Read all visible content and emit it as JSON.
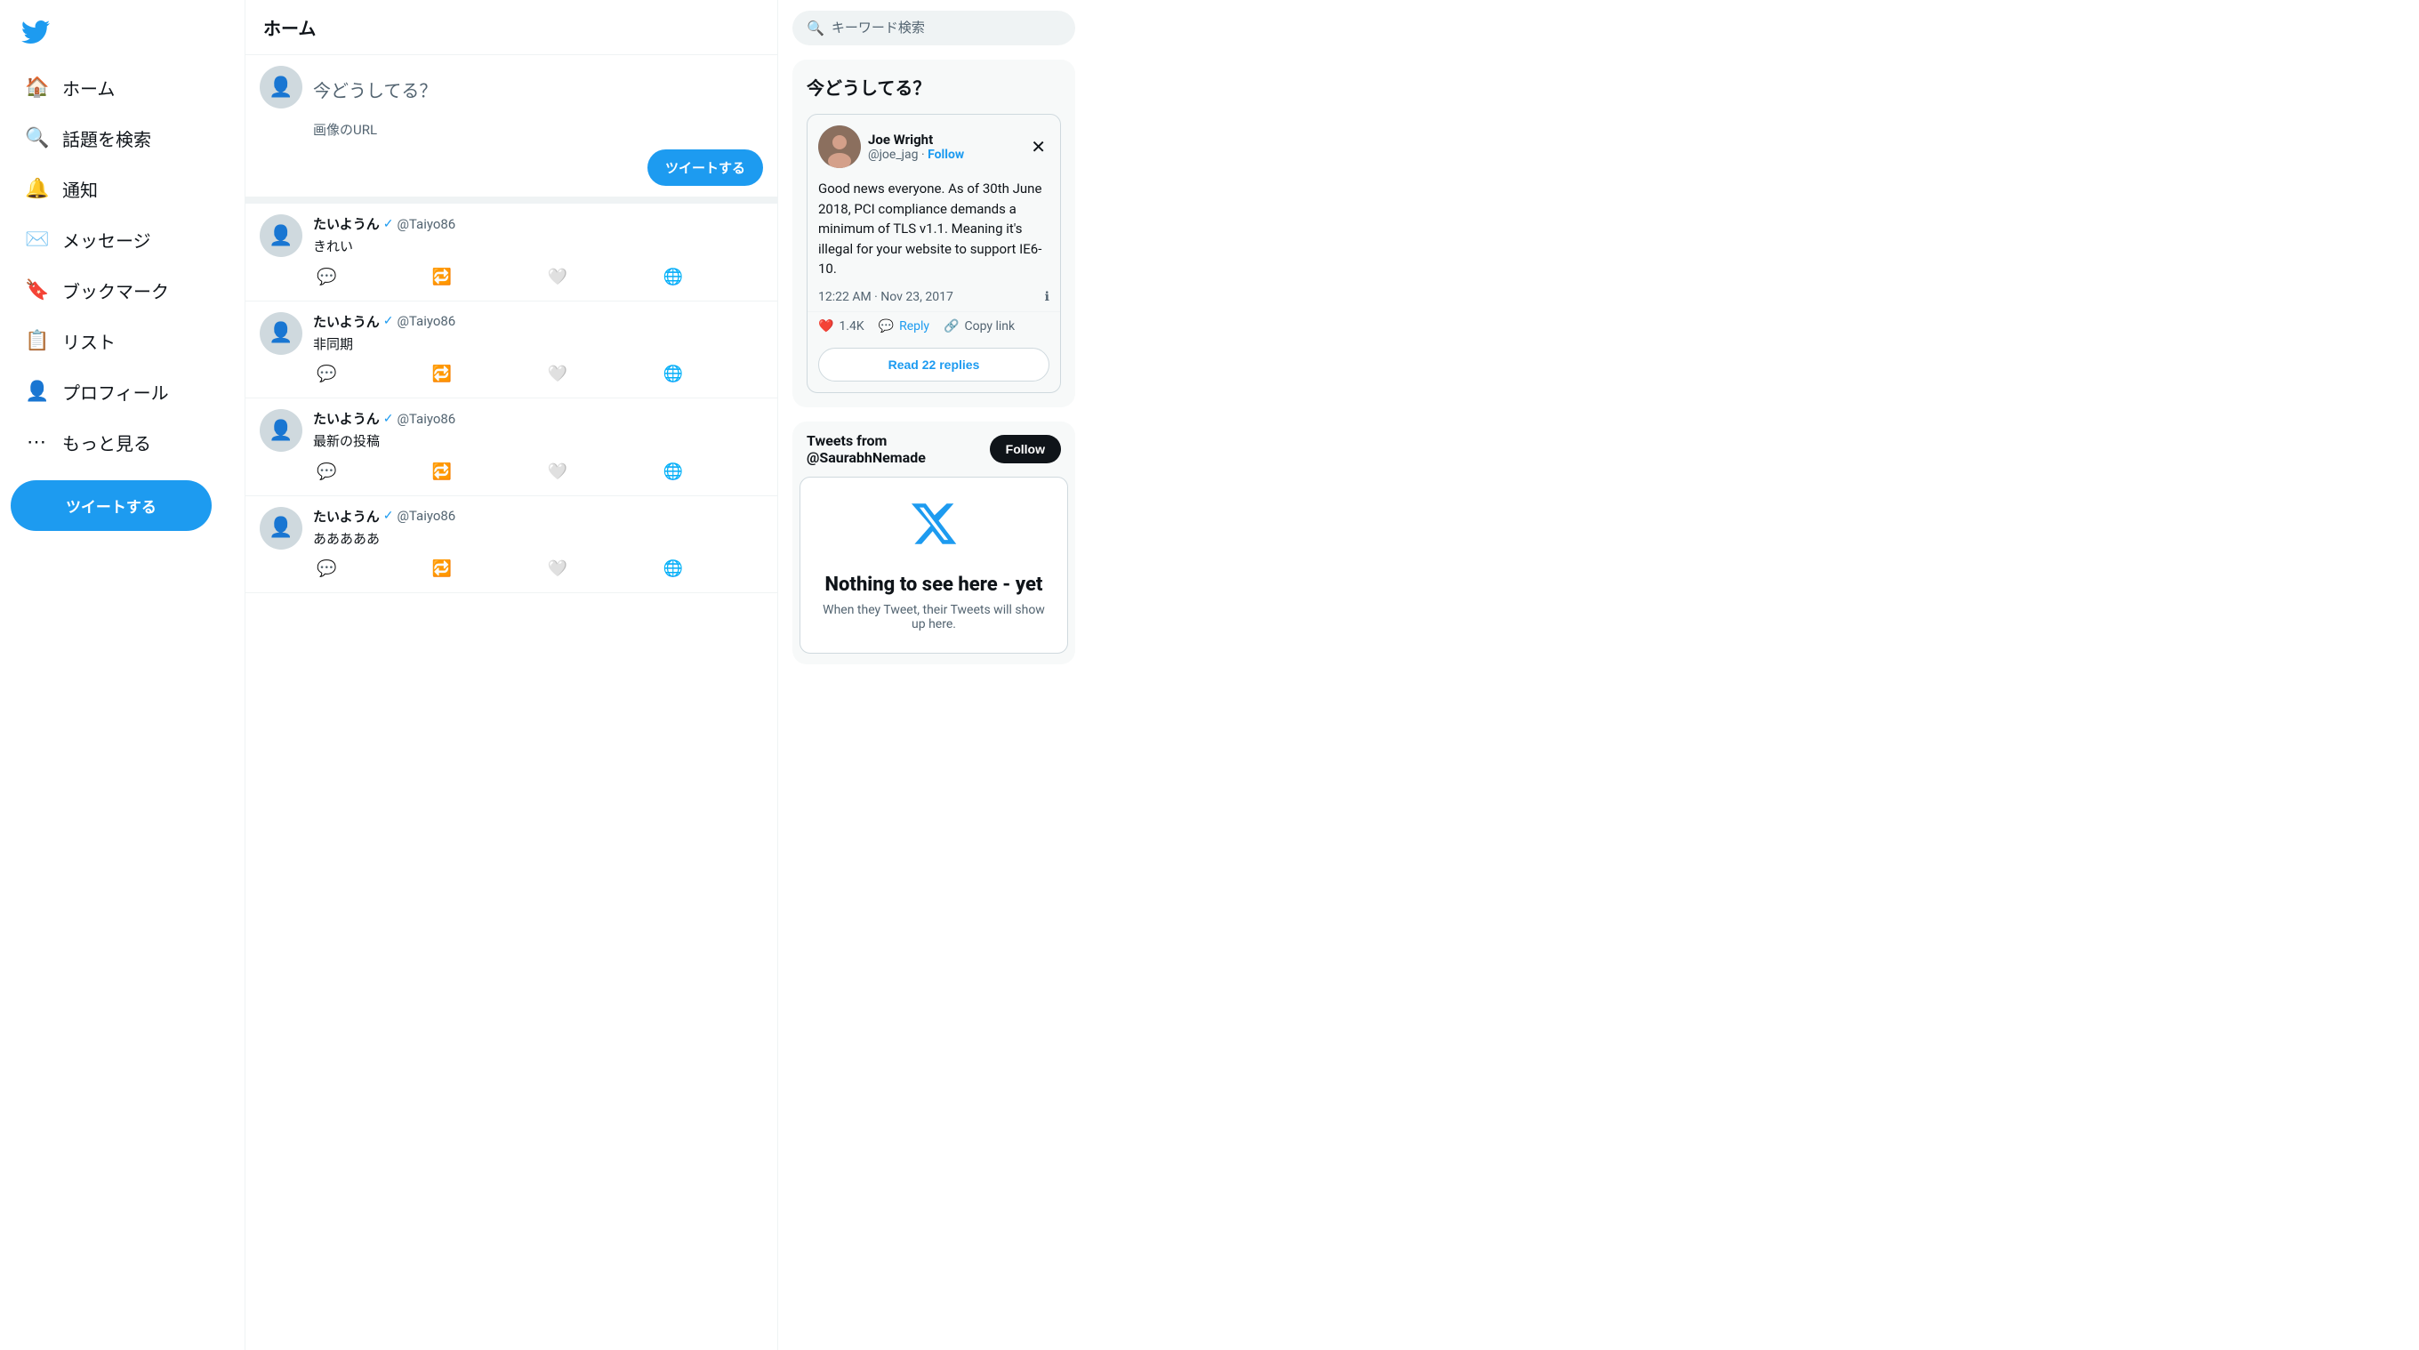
{
  "sidebar": {
    "logo_label": "Twitter",
    "nav_items": [
      {
        "id": "home",
        "label": "ホーム",
        "icon": "🏠"
      },
      {
        "id": "explore",
        "label": "話題を検索",
        "icon": "🔍"
      },
      {
        "id": "notifications",
        "label": "通知",
        "icon": "🔔"
      },
      {
        "id": "messages",
        "label": "メッセージ",
        "icon": "✉️"
      },
      {
        "id": "bookmarks",
        "label": "ブックマーク",
        "icon": "🔖"
      },
      {
        "id": "lists",
        "label": "リスト",
        "icon": "📋"
      },
      {
        "id": "profile",
        "label": "プロフィール",
        "icon": "👤"
      },
      {
        "id": "more",
        "label": "もっと見る",
        "icon": "⋯"
      }
    ],
    "tweet_button_label": "ツイートする"
  },
  "feed": {
    "header_title": "ホーム",
    "compose": {
      "placeholder": "今どうしてる？",
      "image_url_label": "画像のURL",
      "submit_label": "ツイートする"
    },
    "tweets": [
      {
        "id": 1,
        "user_name": "たいようん",
        "user_handle": "@Taiyo86",
        "verified": true,
        "text": "きれい"
      },
      {
        "id": 2,
        "user_name": "たいようん",
        "user_handle": "@Taiyo86",
        "verified": true,
        "text": "非同期"
      },
      {
        "id": 3,
        "user_name": "たいようん",
        "user_handle": "@Taiyo86",
        "verified": true,
        "text": "最新の投稿"
      },
      {
        "id": 4,
        "user_name": "たいようん",
        "user_handle": "@Taiyo86",
        "verified": true,
        "text": "あああああ"
      }
    ]
  },
  "right_sidebar": {
    "search_placeholder": "キーワード検索",
    "trending_title": "今どうしてる？",
    "sidebar_tweet": {
      "user_name": "Joe Wright",
      "user_handle": "@joe_jag",
      "follow_label": "Follow",
      "body": "Good news everyone. As of 30th June 2018, PCI compliance demands a minimum of TLS v1.1. Meaning it's illegal for your website to support IE6-10.",
      "timestamp": "12:22 AM · Nov 23, 2017",
      "likes_count": "1.4K",
      "reply_label": "Reply",
      "copy_link_label": "Copy link",
      "read_replies_label": "Read 22 replies"
    },
    "tweets_from": {
      "title": "Tweets from @SaurabhNemade",
      "follow_label": "Follow",
      "nothing_title": "Nothing to see here - yet",
      "nothing_sub": "When they Tweet, their Tweets will show up here."
    }
  }
}
